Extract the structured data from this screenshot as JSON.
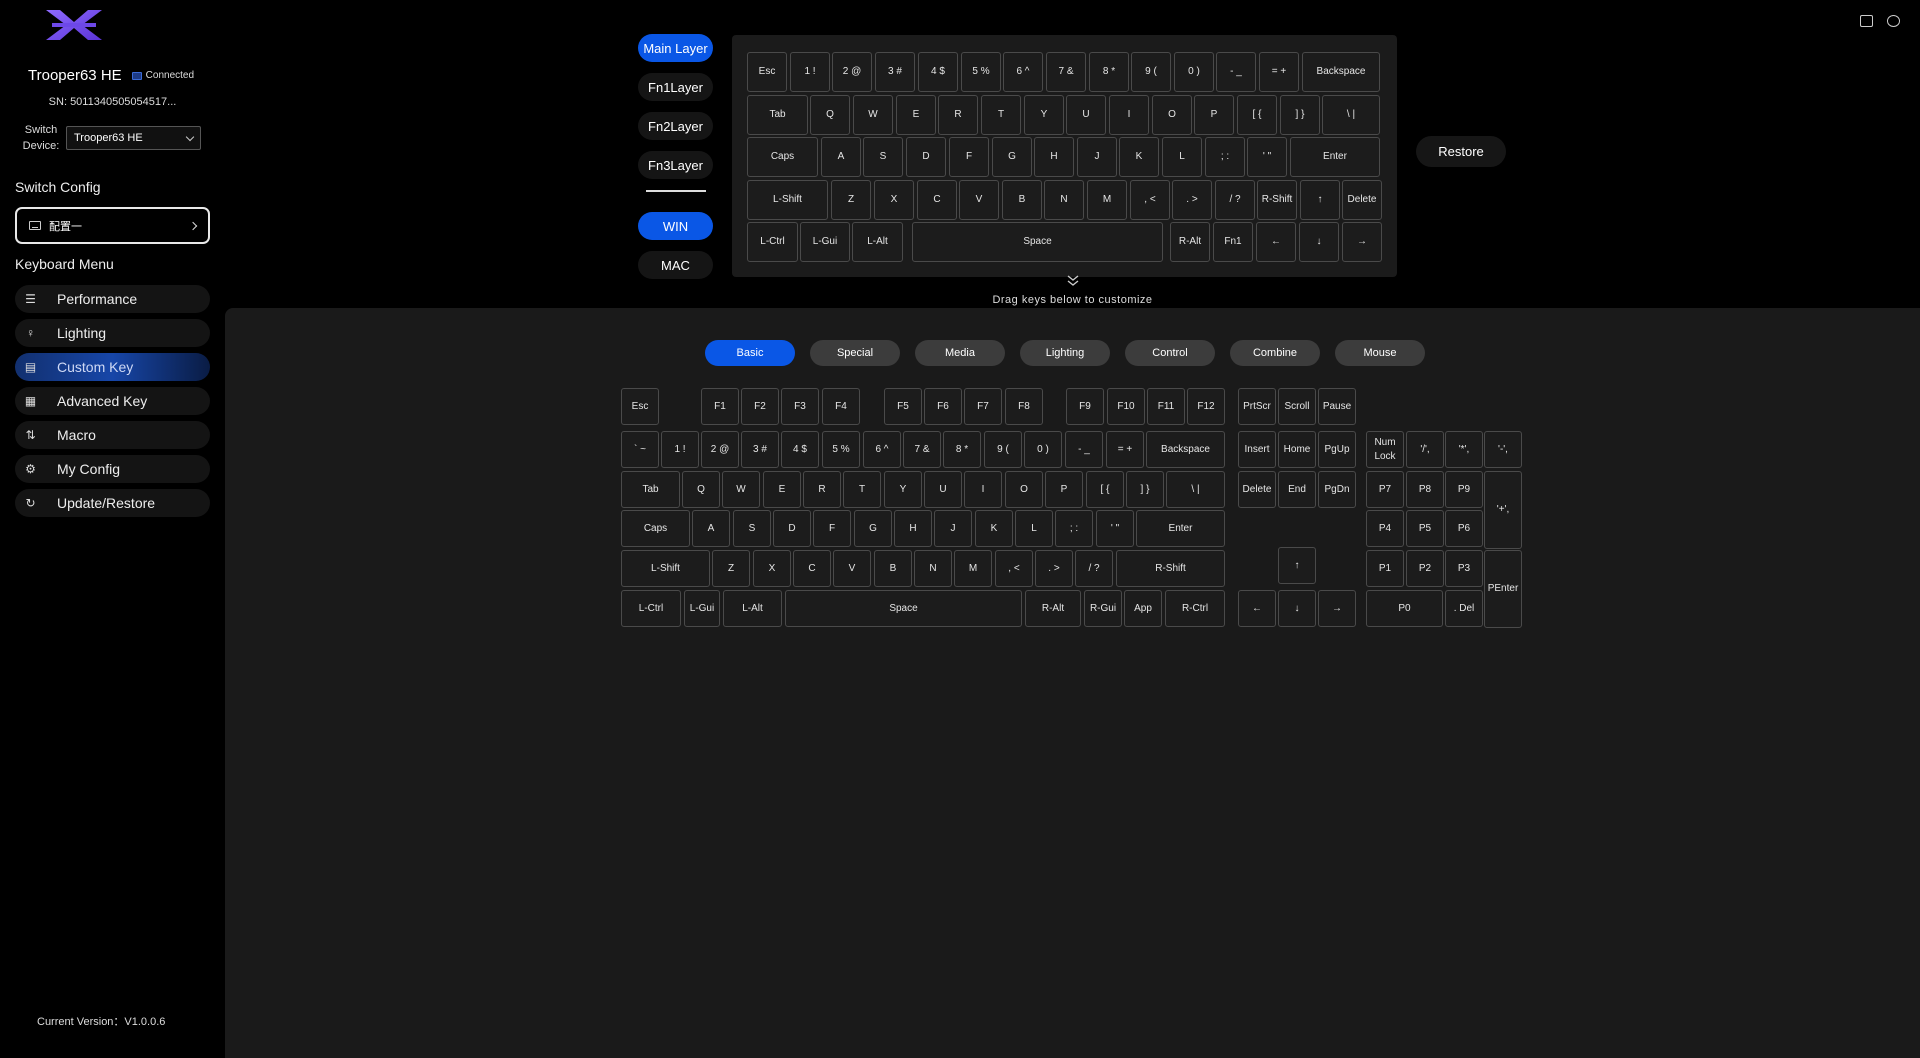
{
  "sidebar": {
    "device_name": "Trooper63 HE",
    "status": "Connected",
    "sn": "SN: 5011340505054517...",
    "switch_device_label": "Switch\nDevice:",
    "device_select_value": "Trooper63 HE",
    "switch_config_title": "Switch Config",
    "config_name": "配置一",
    "keyboard_menu_title": "Keyboard Menu",
    "menu": [
      {
        "label": "Performance",
        "icon": "sliders-icon"
      },
      {
        "label": "Lighting",
        "icon": "bulb-icon"
      },
      {
        "label": "Custom Key",
        "icon": "keyboard-icon",
        "active": true
      },
      {
        "label": "Advanced Key",
        "icon": "grid-icon"
      },
      {
        "label": "Macro",
        "icon": "macro-icon"
      },
      {
        "label": "My Config",
        "icon": "gear-icon"
      },
      {
        "label": "Update/Restore",
        "icon": "refresh-icon"
      }
    ],
    "version": "Current Version：V1.0.0.6"
  },
  "layers": {
    "items": [
      "Main Layer",
      "Fn1Layer",
      "Fn2Layer",
      "Fn3Layer"
    ],
    "active": "Main Layer",
    "os": [
      "WIN",
      "MAC"
    ],
    "os_active": "WIN"
  },
  "restore_label": "Restore",
  "drag_hint": "Drag keys below to customize",
  "top_keyboard": [
    [
      "Esc",
      "1 !",
      "2 @",
      "3 #",
      "4 $",
      "5 %",
      "6 ^",
      "7 &",
      "8 *",
      "9 (",
      "0 )",
      "- _",
      "= +",
      "Backspace"
    ],
    [
      "Tab",
      "Q",
      "W",
      "E",
      "R",
      "T",
      "Y",
      "U",
      "I",
      "O",
      "P",
      "[ {",
      "] }",
      "\\ |"
    ],
    [
      "Caps",
      "A",
      "S",
      "D",
      "F",
      "G",
      "H",
      "J",
      "K",
      "L",
      "; :",
      "' \"",
      "Enter"
    ],
    [
      "L-Shift",
      "Z",
      "X",
      "C",
      "V",
      "B",
      "N",
      "M",
      ", <",
      ". >",
      "/ ?",
      "R-Shift",
      "↑",
      "Delete"
    ],
    [
      "L-Ctrl",
      "L-Gui",
      "L-Alt",
      "Space",
      "R-Alt",
      "Fn1",
      "←",
      "↓",
      "→"
    ]
  ],
  "categories": [
    "Basic",
    "Special",
    "Media",
    "Lighting",
    "Control",
    "Combine",
    "Mouse"
  ],
  "category_active": "Basic",
  "full_keyboard": {
    "row0": [
      "Esc",
      "F1",
      "F2",
      "F3",
      "F4",
      "F5",
      "F6",
      "F7",
      "F8",
      "F9",
      "F10",
      "F11",
      "F12",
      "PrtScr",
      "Scroll",
      "Pause"
    ],
    "row1": [
      "` ~",
      "1 !",
      "2 @",
      "3 #",
      "4 $",
      "5 %",
      "6 ^",
      "7 &",
      "8 *",
      "9 (",
      "0 )",
      "- _",
      "= +",
      "Backspace",
      "Insert",
      "Home",
      "PgUp",
      "Num\nLock",
      "'/',",
      "'*',",
      "'-',"
    ],
    "row2": [
      "Tab",
      "Q",
      "W",
      "E",
      "R",
      "T",
      "Y",
      "U",
      "I",
      "O",
      "P",
      "[ {",
      "] }",
      "\\ |",
      "Delete",
      "End",
      "PgDn",
      "P7",
      "P8",
      "P9",
      "'+',"
    ],
    "row3": [
      "Caps",
      "A",
      "S",
      "D",
      "F",
      "G",
      "H",
      "J",
      "K",
      "L",
      "; :",
      "' \"",
      "Enter",
      "P4",
      "P5",
      "P6"
    ],
    "row4": [
      "L-Shift",
      "Z",
      "X",
      "C",
      "V",
      "B",
      "N",
      "M",
      ", <",
      ". >",
      "/ ?",
      "R-Shift",
      "↑",
      "P1",
      "P2",
      "P3",
      "PEnter"
    ],
    "row5": [
      "L-Ctrl",
      "L-Gui",
      "L-Alt",
      "Space",
      "R-Alt",
      "R-Gui",
      "App",
      "R-Ctrl",
      "←",
      "↓",
      "→",
      "P0",
      ". Del"
    ]
  }
}
